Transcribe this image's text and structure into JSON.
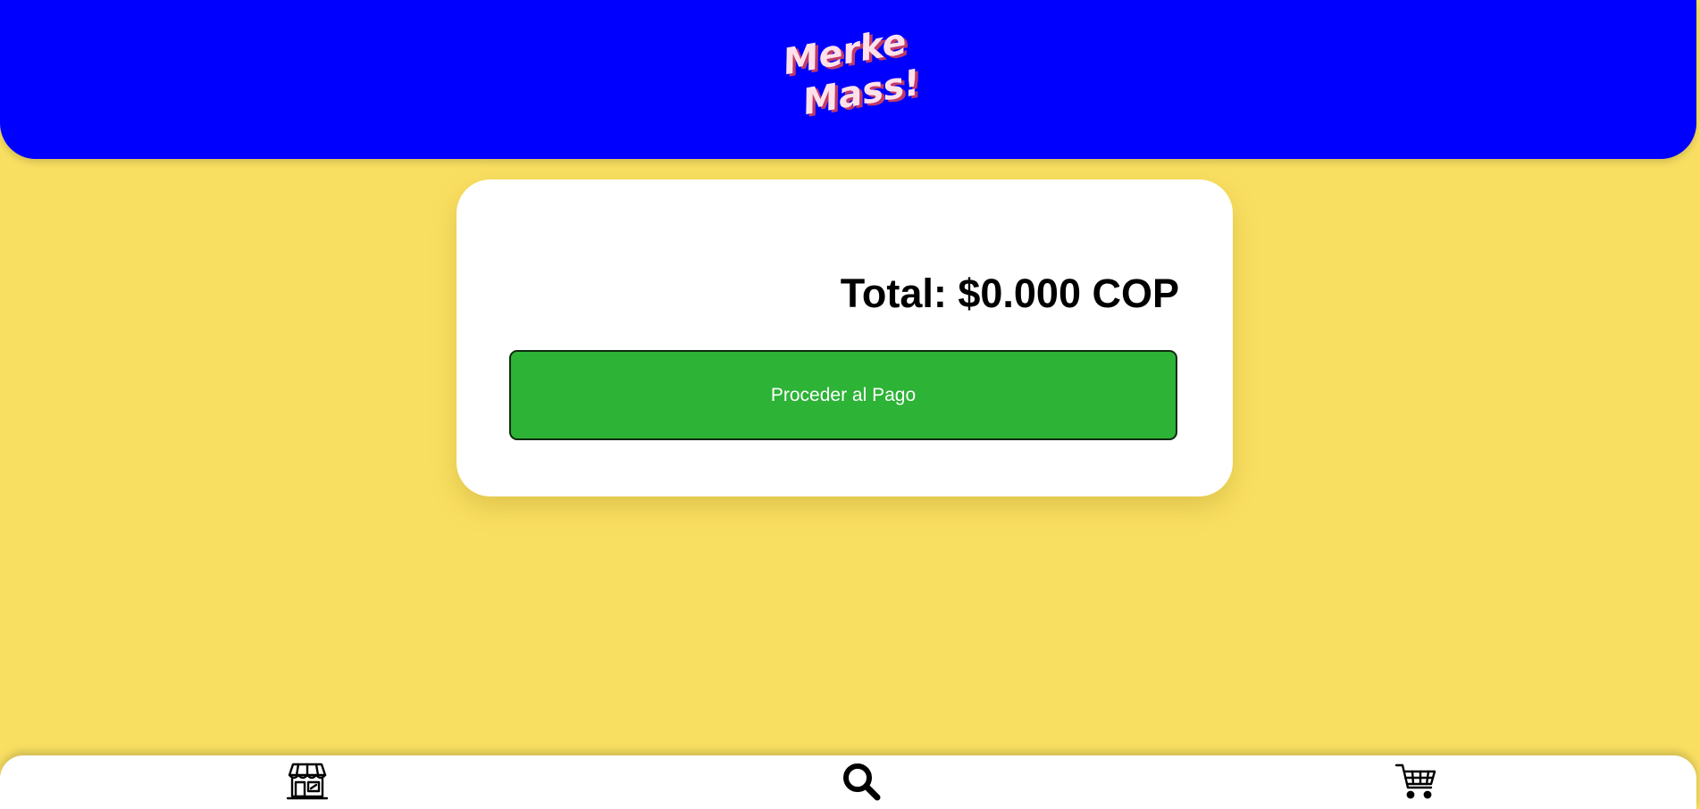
{
  "header": {
    "logo_text_line1": "Merke",
    "logo_text_line2": "Mass!",
    "background_color": "#0000ff"
  },
  "page": {
    "background_color": "#f9df61"
  },
  "summary": {
    "total_label": "Total: $0.000 COP",
    "checkout_button_label": "Proceder al Pago",
    "button_color": "#2db336"
  },
  "bottom_nav": {
    "items": [
      {
        "icon": "store-icon"
      },
      {
        "icon": "search-icon"
      },
      {
        "icon": "cart-icon"
      }
    ]
  }
}
